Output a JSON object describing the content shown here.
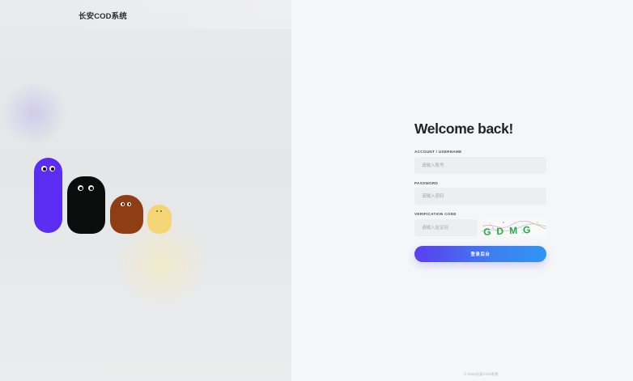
{
  "brand": {
    "name": "长安COD系统"
  },
  "form": {
    "title": "Welcome back!",
    "account_label": "ACCOUNT / USERNAME",
    "account_placeholder": "请输入账号",
    "password_label": "PASSWORD",
    "password_placeholder": "请输入密码",
    "code_label": "VERIFICATION CODE",
    "code_placeholder": "请输入验证码",
    "captcha_text": "GDMG",
    "login_button": "登录后台"
  },
  "footer": {
    "text": "© 2026长安COD系统"
  },
  "colors": {
    "char_purple": "#5b2cf1",
    "char_black": "#0b0d0d",
    "char_brown": "#8f3d12",
    "char_yellow": "#f4d676",
    "button_start": "#5b3df0",
    "button_end": "#2f95f2",
    "captcha_text": "#2aa845"
  }
}
